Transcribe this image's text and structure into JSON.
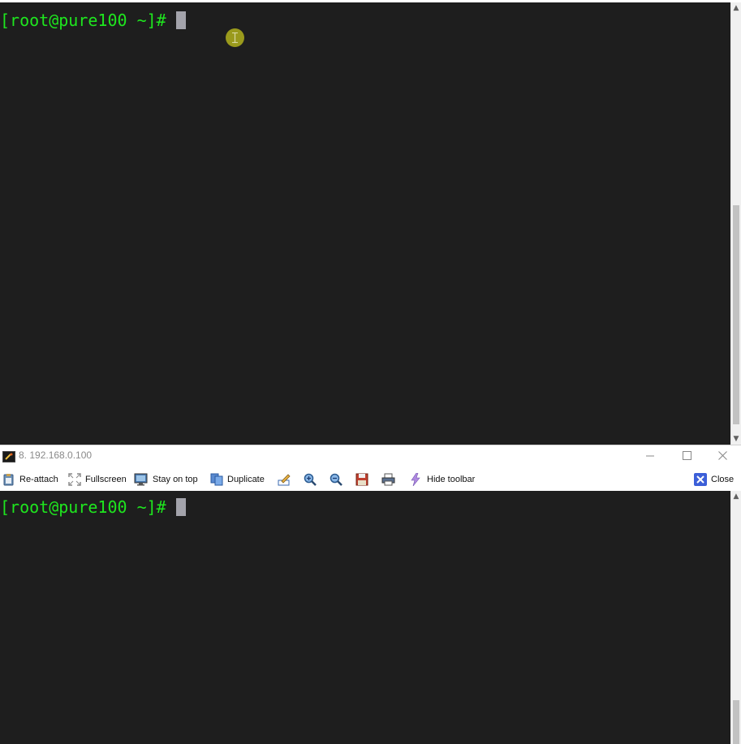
{
  "top_terminal": {
    "prompt": "[root@pure100 ~]#"
  },
  "window2": {
    "title": "8. 192.168.0.100",
    "controls": {
      "minimize": "—",
      "maximize": "☐",
      "close": "✕"
    },
    "toolbar": {
      "reattach": "Re-attach",
      "fullscreen": "Fullscreen",
      "stay_on_top": "Stay on top",
      "duplicate": "Duplicate",
      "hide_toolbar": "Hide toolbar",
      "close": "Close"
    },
    "terminal": {
      "prompt": "[root@pure100 ~]#"
    }
  },
  "colors": {
    "terminal_bg": "#1e1e1e",
    "prompt_green": "#1ee61e",
    "cursor": "#a3a3ab",
    "mouse_highlight": "#9a9a1c",
    "close_icon_blue": "#3c5fd8"
  },
  "icons": {
    "reattach": "clipboard-icon",
    "fullscreen": "fullscreen-icon",
    "stay_on_top": "monitor-icon",
    "duplicate": "duplicate-icon",
    "edit": "edit-icon",
    "zoom_in": "zoom-in-icon",
    "zoom_out": "zoom-out-icon",
    "save": "save-icon",
    "print": "printer-icon",
    "hide_toolbar": "lightning-icon",
    "close": "close-x-icon"
  }
}
